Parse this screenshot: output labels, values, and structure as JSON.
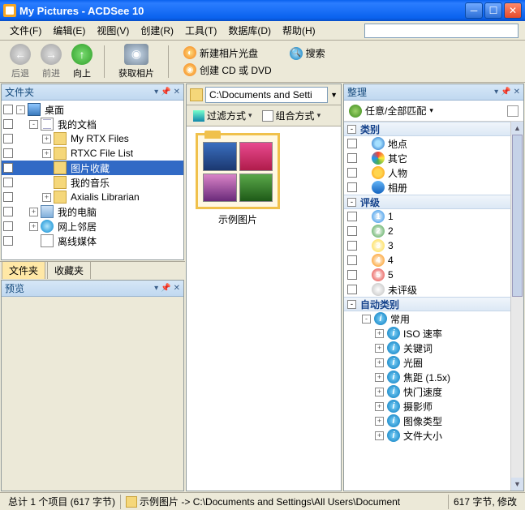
{
  "window": {
    "title": "My Pictures - ACDSee 10"
  },
  "menu": {
    "file": "文件(F)",
    "edit": "编辑(E)",
    "view": "视图(V)",
    "create": "创建(R)",
    "tools": "工具(T)",
    "database": "数据库(D)",
    "help": "帮助(H)"
  },
  "toolbar": {
    "back": "后退",
    "forward": "前进",
    "up": "向上",
    "import": "获取相片",
    "new_disc": "新建相片光盘",
    "search": "搜索",
    "create_cd": "创建 CD 或 DVD"
  },
  "left": {
    "panel_title": "文件夹",
    "tree": [
      {
        "level": 0,
        "exp": "-",
        "icon": "ico-desktop",
        "label": "桌面"
      },
      {
        "level": 1,
        "exp": "-",
        "icon": "ico-docs",
        "label": "我的文档"
      },
      {
        "level": 2,
        "exp": "+",
        "icon": "ico-folder",
        "label": "My RTX Files"
      },
      {
        "level": 2,
        "exp": "+",
        "icon": "ico-folder",
        "label": "RTXC File List"
      },
      {
        "level": 2,
        "exp": "",
        "icon": "ico-folder",
        "label": "图片收藏",
        "selected": true
      },
      {
        "level": 2,
        "exp": "",
        "icon": "ico-folder",
        "label": "我的音乐"
      },
      {
        "level": 2,
        "exp": "+",
        "icon": "ico-folder",
        "label": "Axialis Librarian"
      },
      {
        "level": 1,
        "exp": "+",
        "icon": "ico-computer",
        "label": "我的电脑"
      },
      {
        "level": 1,
        "exp": "+",
        "icon": "ico-network",
        "label": "网上邻居"
      },
      {
        "level": 1,
        "exp": "",
        "icon": "ico-offline",
        "label": "离线媒体"
      }
    ],
    "tabs": {
      "folders": "文件夹",
      "favorites": "收藏夹"
    },
    "preview_title": "预览"
  },
  "middle": {
    "address": "C:\\Documents and Setti",
    "filter": "过滤方式",
    "group": "组合方式",
    "thumb_caption": "示例图片"
  },
  "right": {
    "panel_title": "整理",
    "match": "任意/全部匹配",
    "sections": {
      "category": {
        "title": "类别",
        "items": [
          {
            "icon": "ico-globe",
            "label": "地点"
          },
          {
            "icon": "ico-color",
            "label": "其它"
          },
          {
            "icon": "ico-people",
            "label": "人物"
          },
          {
            "icon": "ico-book",
            "label": "相册"
          }
        ]
      },
      "rating": {
        "title": "评级",
        "items": [
          {
            "color": "#1e88e5",
            "label": "1"
          },
          {
            "color": "#43a047",
            "label": "2"
          },
          {
            "color": "#fdd835",
            "label": "3"
          },
          {
            "color": "#fb8c00",
            "label": "4"
          },
          {
            "color": "#e53935",
            "label": "5"
          },
          {
            "color": "#bdbdbd",
            "label": "未评级"
          }
        ]
      },
      "auto": {
        "title": "自动类别",
        "common": "常用",
        "items": [
          "ISO 速率",
          "关键词",
          "光圈",
          "焦距 (1.5x)",
          "快门速度",
          "摄影师",
          "图像类型",
          "文件大小"
        ]
      }
    }
  },
  "status": {
    "count": "总计 1 个项目 (617 字节)",
    "path": "示例图片 -> C:\\Documents and Settings\\All Users\\Document",
    "size": "617 字节, 修改"
  }
}
